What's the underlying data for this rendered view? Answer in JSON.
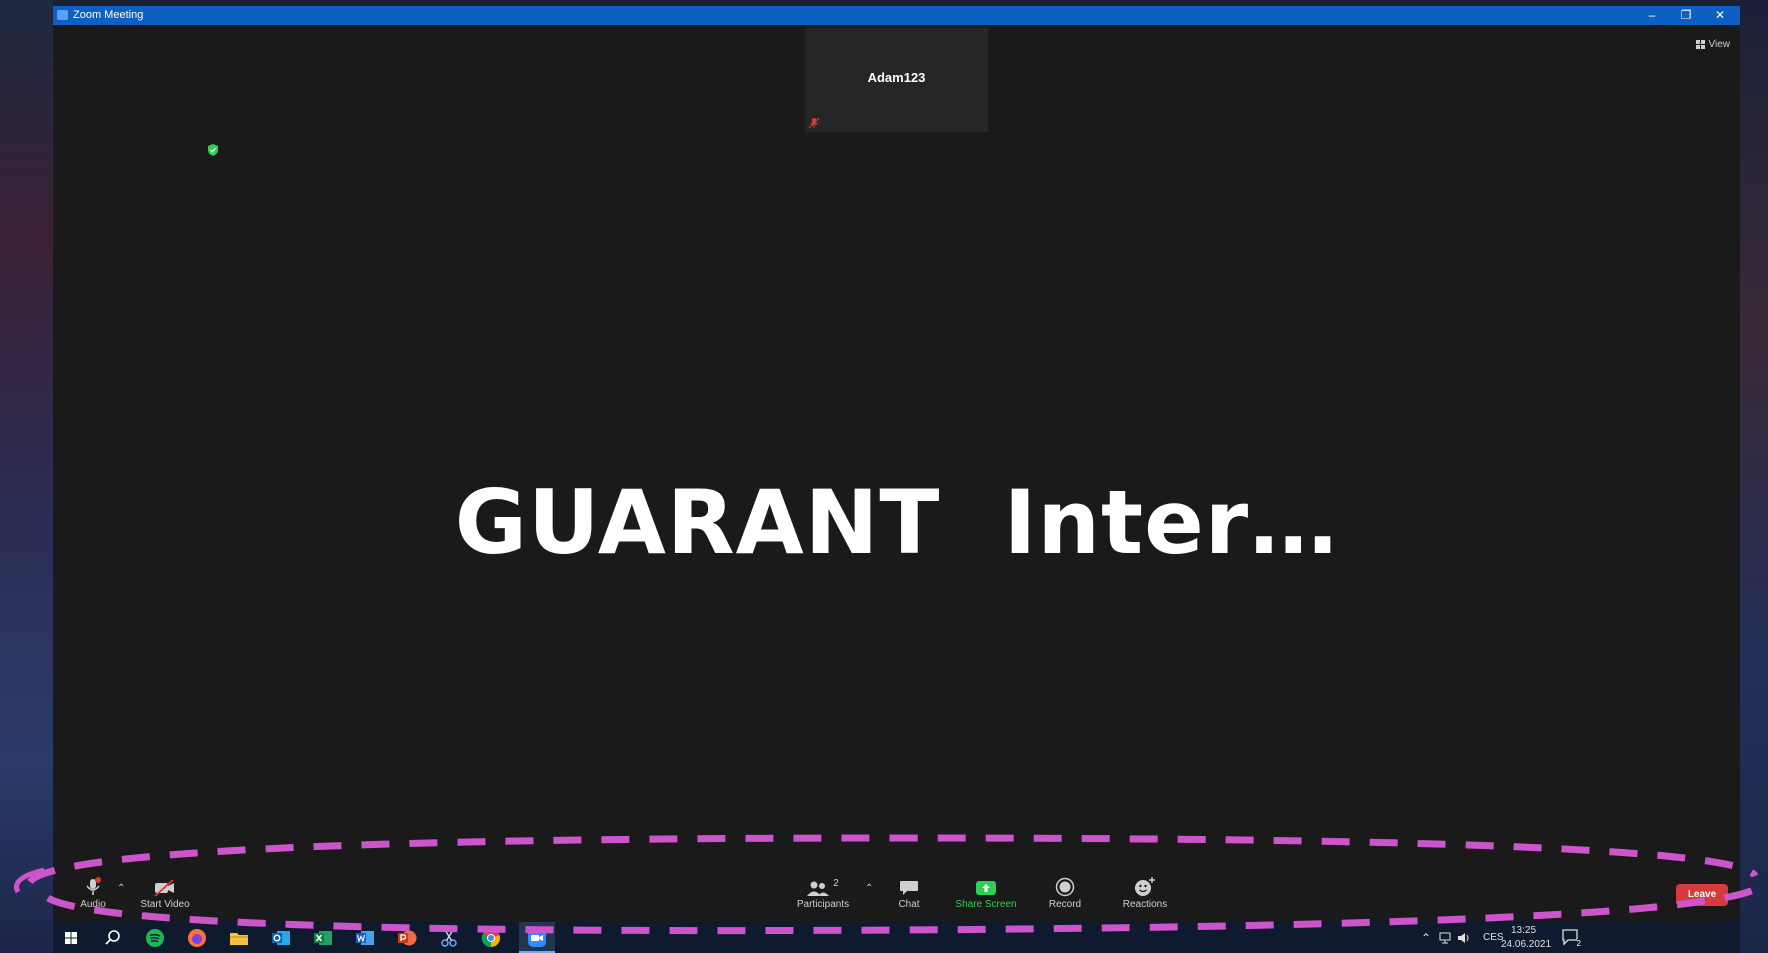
{
  "window": {
    "title": "Zoom Meeting",
    "view_label": "View"
  },
  "participant_tile": {
    "name": "Adam123"
  },
  "shared_screen": {
    "text": "GUARANT  Inter…"
  },
  "toolbar": {
    "audio_label": "Audio",
    "start_video_label": "Start Video",
    "participants_label": "Participants",
    "participants_count": "2",
    "chat_label": "Chat",
    "share_screen_label": "Share Screen",
    "record_label": "Record",
    "reactions_label": "Reactions",
    "leave_label": "Leave"
  },
  "taskbar": {
    "language": "CES",
    "time": "13:25",
    "date": "24.06.2021",
    "notification_count": "2",
    "apps": [
      "windows-start",
      "search",
      "spotify",
      "firefox",
      "file-explorer",
      "outlook",
      "excel",
      "word",
      "powerpoint",
      "snipping-tool",
      "chrome",
      "zoom"
    ]
  },
  "colors": {
    "titlebar": "#0d5fc1",
    "meeting_bg": "#1a1a1a",
    "share_screen_green": "#2fcf54",
    "leave_red": "#d63a3a",
    "annotation_magenta": "#cc55cc"
  }
}
